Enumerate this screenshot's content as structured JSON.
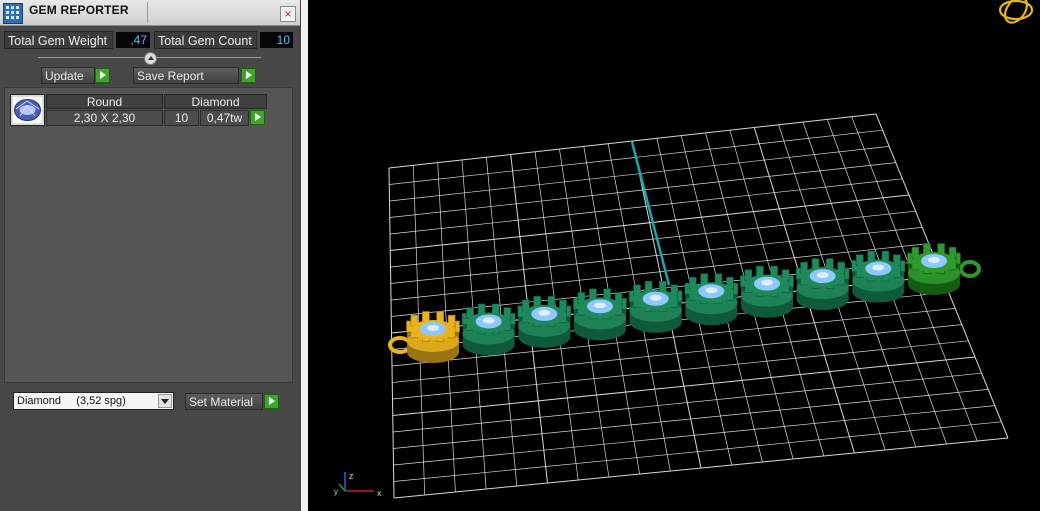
{
  "panel": {
    "title": "GEM REPORTER",
    "close_label": "×",
    "total_weight_label": "Total Gem Weight",
    "total_weight_value": ",47",
    "total_count_label": "Total Gem Count",
    "total_count_value": "10",
    "update_label": "Update",
    "save_report_label": "Save Report",
    "table": {
      "headers": [
        "Round",
        "Diamond"
      ],
      "size": "2,30 X 2,30",
      "count": "10",
      "weight": "0,47tw"
    },
    "material_select": "Diamond     (3,52 spg)",
    "set_material_label": "Set Material"
  },
  "viewport": {
    "axis_labels": {
      "z": "z",
      "x": "x",
      "y": "y"
    },
    "gem_count": 10,
    "colors": {
      "grid": "#d9d9d9",
      "setting_green": "#1e8a5c",
      "setting_gold": "#e8b31c",
      "gem": "#8ec8ff",
      "axis_cyan": "#19a7a7"
    }
  }
}
